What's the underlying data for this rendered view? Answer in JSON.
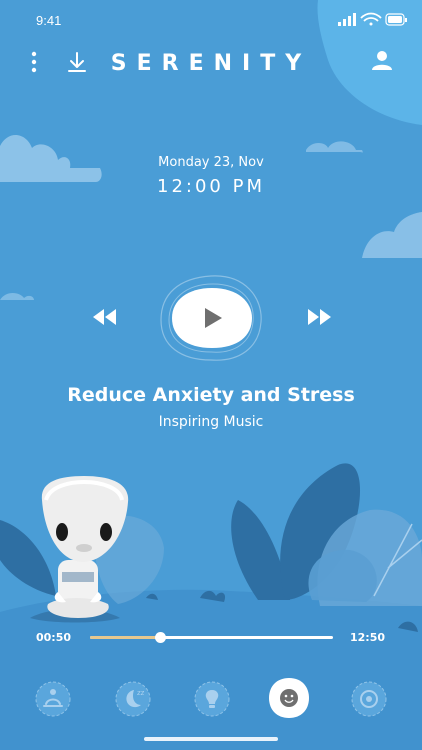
{
  "status": {
    "time": "9:41"
  },
  "header": {
    "brand": "SERENITY"
  },
  "now_playing": {
    "date": "Monday 23, Nov",
    "time": "12:00 PM",
    "title": "Reduce Anxiety and Stress",
    "subtitle": "Inspiring Music"
  },
  "progress": {
    "elapsed": "00:50",
    "total": "12:50",
    "fraction": 0.29
  },
  "bottom_nav": [
    {
      "icon": "meditation-icon",
      "active": false
    },
    {
      "icon": "moon-icon",
      "active": false
    },
    {
      "icon": "lightbulb-icon",
      "active": false
    },
    {
      "icon": "smiley-icon",
      "active": true
    },
    {
      "icon": "eye-icon",
      "active": false
    }
  ],
  "colors": {
    "background": "#4a9dd6",
    "accent_light": "#5cb4e8",
    "progress_fill": "#e6c88f",
    "foliage_dark": "#2e6fa3"
  }
}
